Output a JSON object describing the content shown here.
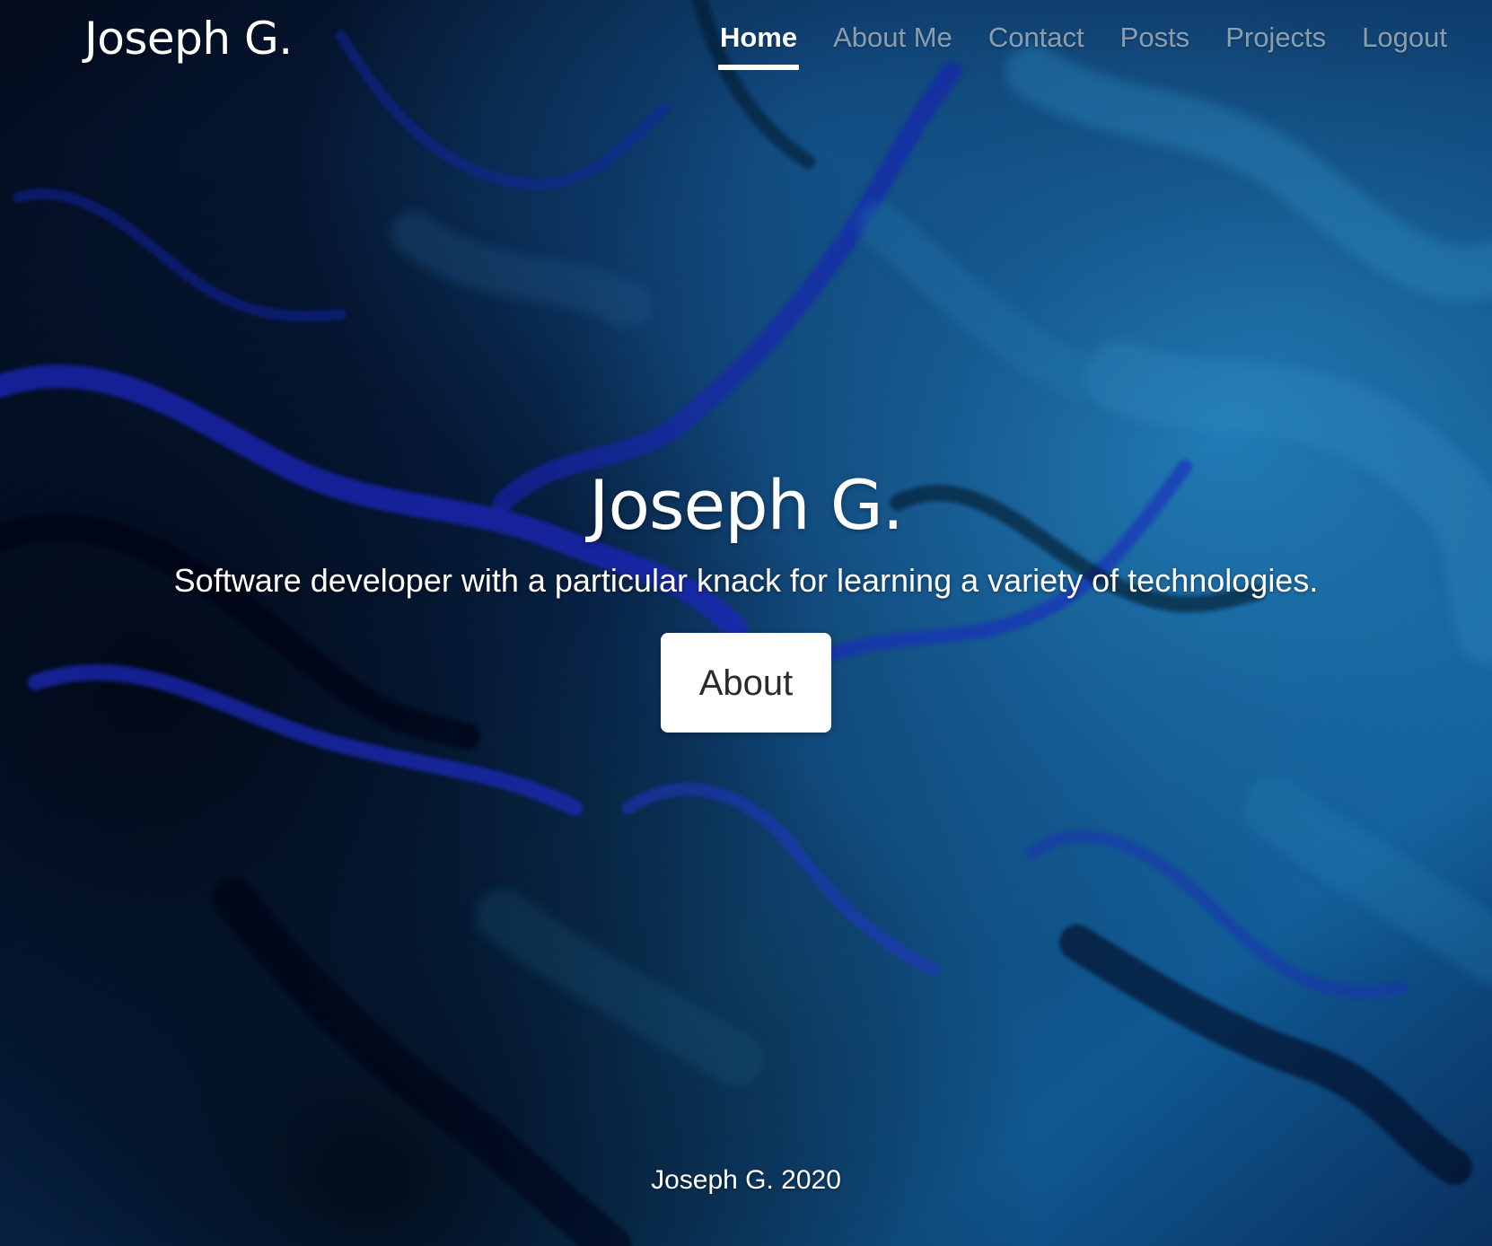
{
  "colors": {
    "background_dark": "#06122a",
    "accent_blue": "#1f8fd6",
    "accent_indigo": "#1a2fd8",
    "button_bg": "#ffffff",
    "button_text": "#2b2b2b",
    "nav_inactive": "rgba(255,255,255,0.52)"
  },
  "background": {
    "icon": "abstract-fluid-paint-background"
  },
  "navbar": {
    "brand": "Joseph G.",
    "links": [
      {
        "label": "Home",
        "active": true
      },
      {
        "label": "About Me",
        "active": false
      },
      {
        "label": "Contact",
        "active": false
      },
      {
        "label": "Posts",
        "active": false
      },
      {
        "label": "Projects",
        "active": false
      },
      {
        "label": "Logout",
        "active": false
      }
    ]
  },
  "hero": {
    "title": "Joseph G.",
    "subtitle": "Software developer with a particular knack for learning a variety of technologies.",
    "button_label": "About"
  },
  "footer": {
    "text": "Joseph G. 2020"
  }
}
